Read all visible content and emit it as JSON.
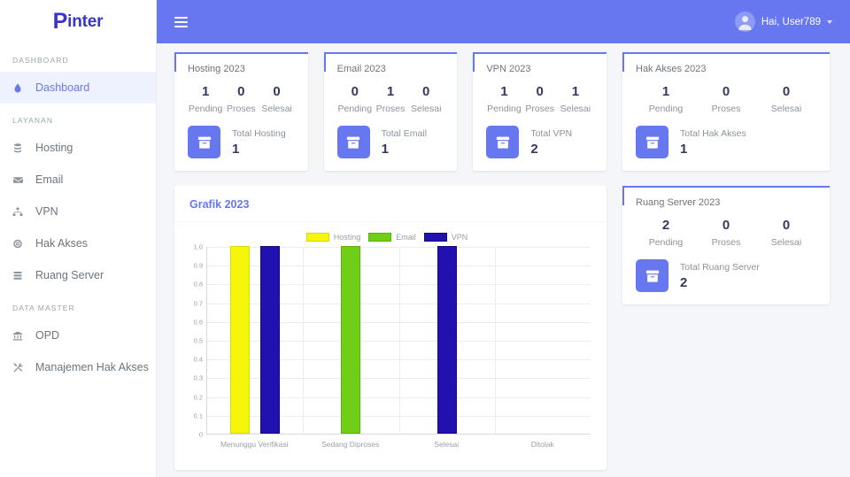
{
  "brand": {
    "name_prefix": "P",
    "name_rest": "inter",
    "color": "#3b34c9"
  },
  "topbar": {
    "menu_icon": "hamburger-icon",
    "user_greeting": "Hai, User789",
    "avatar_icon": "user-avatar-icon",
    "caret_icon": "chevron-down-icon",
    "bg_color": "#6777ef"
  },
  "sidebar": {
    "sections": [
      {
        "heading": "DASHBOARD",
        "items": [
          {
            "label": "Dashboard",
            "icon": "water-drop-icon",
            "active": true
          }
        ]
      },
      {
        "heading": "LAYANAN",
        "items": [
          {
            "label": "Hosting",
            "icon": "database-icon",
            "active": false
          },
          {
            "label": "Email",
            "icon": "envelope-icon",
            "active": false
          },
          {
            "label": "VPN",
            "icon": "sitemap-icon",
            "active": false
          },
          {
            "label": "Hak Akses",
            "icon": "globe-badge-icon",
            "active": false
          },
          {
            "label": "Ruang Server",
            "icon": "server-icon",
            "active": false
          }
        ]
      },
      {
        "heading": "DATA MASTER",
        "items": [
          {
            "label": "OPD",
            "icon": "bank-icon",
            "active": false
          },
          {
            "label": "Manajemen Hak Akses",
            "icon": "tools-icon",
            "active": false
          }
        ]
      }
    ]
  },
  "stat_cards": {
    "status_labels": [
      "Pending",
      "Proses",
      "Selesai"
    ],
    "top": [
      {
        "title": "Hosting 2023",
        "counts": [
          "1",
          "0",
          "0"
        ],
        "total_label": "Total Hosting",
        "total_value": "1",
        "icon": "archive-box-icon"
      },
      {
        "title": "Email 2023",
        "counts": [
          "0",
          "1",
          "0"
        ],
        "total_label": "Total Email",
        "total_value": "1",
        "icon": "archive-box-icon"
      },
      {
        "title": "VPN 2023",
        "counts": [
          "1",
          "0",
          "1"
        ],
        "total_label": "Total VPN",
        "total_value": "2",
        "icon": "archive-box-icon"
      }
    ],
    "side": [
      {
        "title": "Hak Akses 2023",
        "counts": [
          "1",
          "0",
          "0"
        ],
        "total_label": "Total Hak Akses",
        "total_value": "1",
        "icon": "archive-box-icon"
      },
      {
        "title": "Ruang Server 2023",
        "counts": [
          "2",
          "0",
          "0"
        ],
        "total_label": "Total Ruang Server",
        "total_value": "2",
        "icon": "archive-box-icon"
      }
    ]
  },
  "chart_card": {
    "title": "Grafik 2023"
  },
  "chart_data": {
    "type": "bar",
    "title": "Grafik 2023",
    "xlabel": "",
    "ylabel": "",
    "ylim": [
      0,
      1.0
    ],
    "ytick_labels": [
      "1.0",
      "0.9",
      "0.8",
      "0.7",
      "0.6",
      "0.5",
      "0.4",
      "0.3",
      "0.2",
      "0.1",
      "0"
    ],
    "ytick_values": [
      1.0,
      0.9,
      0.8,
      0.7,
      0.6,
      0.5,
      0.4,
      0.3,
      0.2,
      0.1,
      0
    ],
    "grid": true,
    "legend_position": "top-center",
    "categories": [
      "Menunggu Verifikasi",
      "Sedang Diproses",
      "Selesai",
      "Ditolak"
    ],
    "series": [
      {
        "name": "Hosting",
        "color": "#f6f60a",
        "border": "#d8d800",
        "values": [
          1,
          0,
          0,
          0
        ]
      },
      {
        "name": "Email",
        "color": "#6fcf16",
        "border": "#5bb00c",
        "values": [
          0,
          1,
          0,
          0
        ]
      },
      {
        "name": "VPN",
        "color": "#2112b0",
        "border": "#140a78",
        "values": [
          1,
          0,
          1,
          0
        ]
      }
    ]
  }
}
